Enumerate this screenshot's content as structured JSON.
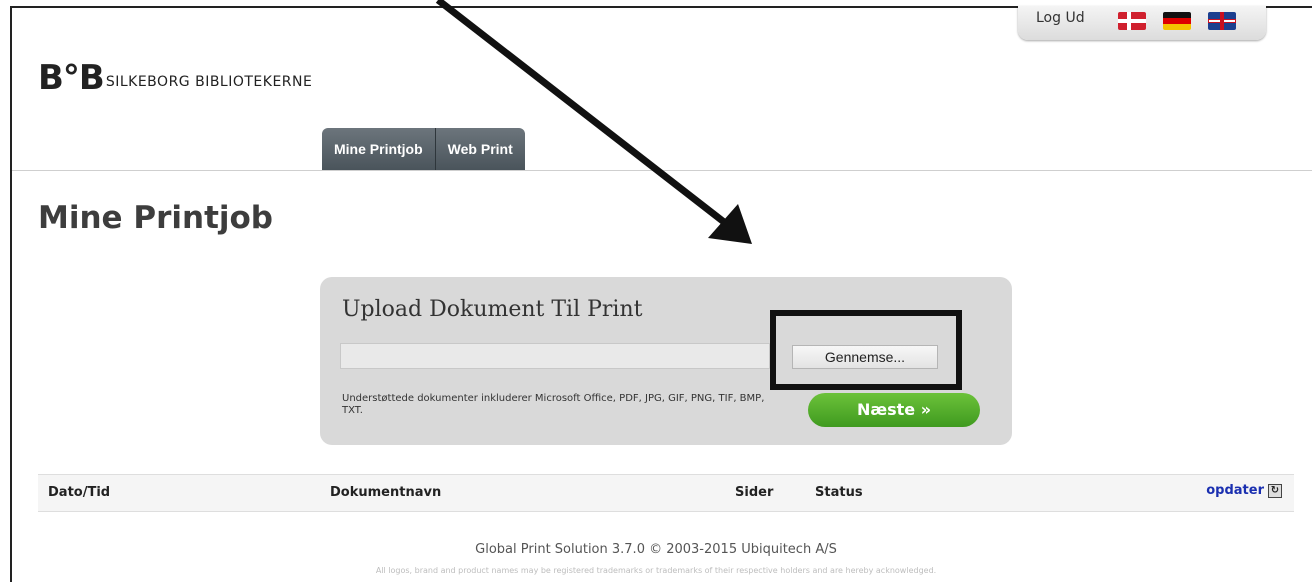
{
  "header": {
    "logout_label": "Log Ud",
    "languages": [
      "Danish flag",
      "German flag",
      "UK flag"
    ],
    "logo_mark": "B°B",
    "logo_text": "SILKEBORG BIBLIOTEKERNE"
  },
  "tabs": [
    {
      "label": "Mine Printjob"
    },
    {
      "label": "Web Print"
    }
  ],
  "page_title": "Mine Printjob",
  "upload": {
    "title": "Upload Dokument Til Print",
    "file_value": "",
    "browse_label": "Gennemse...",
    "supported_text": "Understøttede dokumenter inkluderer Microsoft Office, PDF, JPG, GIF, PNG, TIF, BMP, TXT.",
    "next_label": "Næste »"
  },
  "table": {
    "columns": [
      "Dato/Tid",
      "Dokumentnavn",
      "Sider",
      "Status"
    ],
    "refresh_label": "opdater"
  },
  "footer": {
    "main": "Global Print Solution 3.7.0 © 2003-2015 Ubiquitech A/S",
    "small": "All logos, brand and product names may be registered trademarks or trademarks of their respective holders and are hereby acknowledged."
  },
  "colors": {
    "tab_bg": "#5a646b",
    "panel_bg": "#d9d9d9",
    "next_button": "#4caf2a",
    "link": "#1a2fb0"
  }
}
